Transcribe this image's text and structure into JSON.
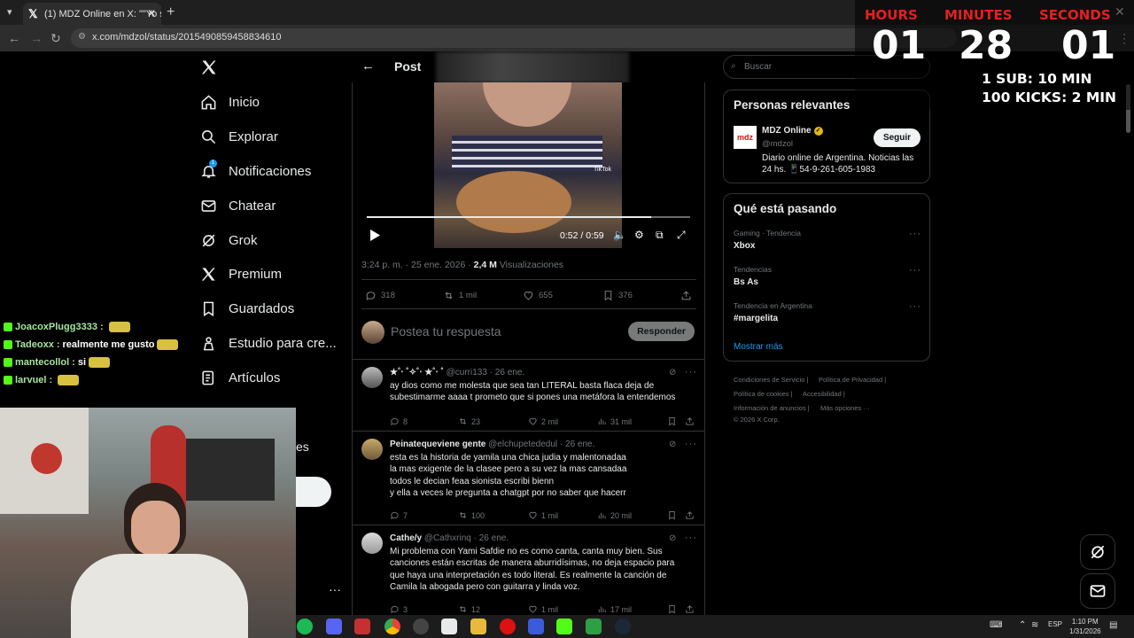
{
  "browser": {
    "tab_title": "(1) MDZ Online en X: \"\"Yo sé qu",
    "url": "x.com/mdzol/status/2015490859458834610"
  },
  "nav": {
    "items": [
      {
        "label": "Inicio",
        "icon": "home-icon"
      },
      {
        "label": "Explorar",
        "icon": "search-icon"
      },
      {
        "label": "Notificaciones",
        "icon": "bell-icon",
        "badge": "1"
      },
      {
        "label": "Chatear",
        "icon": "mail-icon"
      },
      {
        "label": "Grok",
        "icon": "grok-icon"
      },
      {
        "label": "Premium",
        "icon": "x-logo-icon"
      },
      {
        "label": "Guardados",
        "icon": "bookmark-icon"
      },
      {
        "label": "Estudio para cre...",
        "icon": "studio-icon"
      },
      {
        "label": "Artículos",
        "icon": "articles-icon"
      }
    ],
    "partial_label": "es"
  },
  "post": {
    "header": "Post",
    "video_time": "0:52 / 0:59",
    "video_progress": 0.88,
    "watermark": "TikTok",
    "meta_time": "3:24 p. m. · 25 ene. 2026 ·",
    "meta_views": "2,4 M",
    "meta_views_label": "Visualizaciones",
    "stats": {
      "replies": "318",
      "reposts": "1 mil",
      "likes": "655",
      "bookmarks": "376"
    },
    "reply_placeholder": "Postea tu respuesta",
    "reply_button": "Responder"
  },
  "replies": [
    {
      "name": "★˚‧ ˚✧˚‧ ★˚‧ ˚",
      "handle": "@curri133 · 26 ene.",
      "text": "ay dios como me molesta que sea tan LITERAL basta flaca deja de\nsubestimarme aaaa t prometo que si pones una metáfora la entendemos",
      "replies": "8",
      "reposts": "23",
      "likes": "2 mil",
      "views": "31 mil"
    },
    {
      "name": "Peinatequeviene gente",
      "handle": "@elchupetededul · 26 ene.",
      "text": "esta es la historia de yamila una chica judia y malentonadaa\nla mas exigente de la clasee pero a su vez la mas cansadaa\ntodos le decian feaa sionista escribi bienn\ny ella a veces le pregunta a chatgpt por no saber que hacerr",
      "replies": "7",
      "reposts": "100",
      "likes": "1 mil",
      "views": "20 mil"
    },
    {
      "name": "Cathe/y",
      "handle": "@Cathxrinq · 26 ene.",
      "text": "Mi problema con Yami Safdie no es como canta, canta muy bien. Sus\ncanciones están escritas de manera aburridísimas, no deja espacio para\nque haya una interpretación es todo literal. Es realmente la canción de\nCamila la abogada pero con guitarra y linda voz.",
      "replies": "3",
      "reposts": "12",
      "likes": "1 mil",
      "views": "17 mil"
    }
  ],
  "sidebar": {
    "search_placeholder": "Buscar",
    "relevant_title": "Personas relevantes",
    "account_name": "MDZ Online",
    "account_handle": "@mdzol",
    "account_logo": "mdz",
    "account_bio": "Diario online de Argentina. Noticias las\n24 hs. 📱54-9-261-605-1983",
    "follow_button": "Seguir",
    "trends_title": "Qué está pasando",
    "trends": [
      {
        "category": "Gaming · Tendencia",
        "name": "Xbox"
      },
      {
        "category": "Tendencias",
        "name": "Bs As"
      },
      {
        "category": "Tendencia en Argentina",
        "name": "#margelita"
      }
    ],
    "show_more": "Mostrar más",
    "footer": [
      "Condiciones de Servicio |",
      "Política de Privacidad |",
      "Política de cookies |",
      "Accesibilidad |",
      "Información de anuncios |",
      "Más opciones ···",
      "© 2026 X Corp."
    ]
  },
  "overlay": {
    "hours_label": "HOURS",
    "minutes_label": "MINUTES",
    "seconds_label": "SECONDS",
    "hours": "01",
    "minutes": "28",
    "seconds": "01",
    "rule1": "1 SUB: 10 MIN",
    "rule2": "100 KICKS: 2 MIN"
  },
  "chat": [
    {
      "user": "JoacoxPlugg3333 :",
      "msg": ""
    },
    {
      "user": "Tadeoxx :",
      "msg": "realmente me gusto"
    },
    {
      "user": "mantecollol :",
      "msg": "si"
    },
    {
      "user": "larvuel :",
      "msg": ""
    }
  ],
  "taskbar": {
    "lang": "ESP",
    "time": "1:10 PM",
    "date": "1/31/2026"
  },
  "colors": {
    "accent": "#1d9bf0",
    "timer_label": "#e81e1e",
    "bg": "#000000"
  }
}
